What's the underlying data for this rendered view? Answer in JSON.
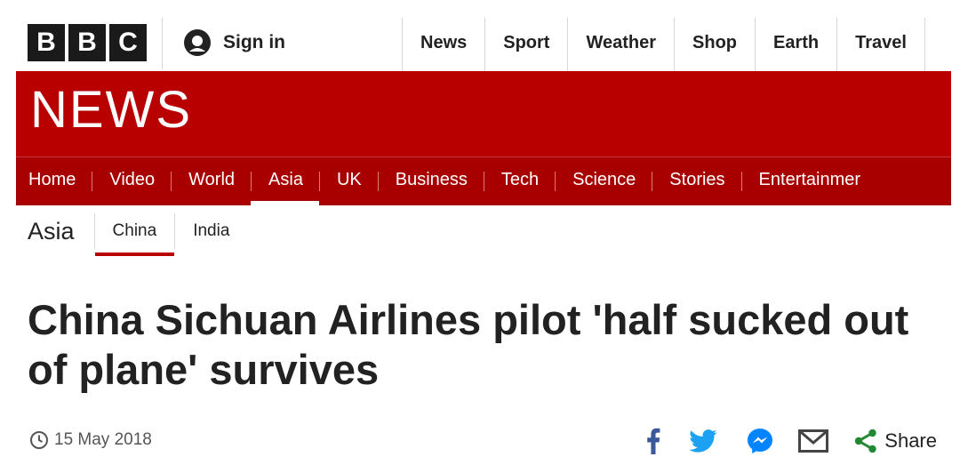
{
  "brand": {
    "letters": [
      "B",
      "B",
      "C"
    ],
    "section_logo": "NEWS",
    "accent_color": "#b80000"
  },
  "account": {
    "signin_label": "Sign in",
    "icon": "user-icon"
  },
  "top_nav": [
    "News",
    "Sport",
    "Weather",
    "Shop",
    "Earth",
    "Travel"
  ],
  "section_nav": {
    "items": [
      "Home",
      "Video",
      "World",
      "Asia",
      "UK",
      "Business",
      "Tech",
      "Science",
      "Stories",
      "Entertainmer"
    ],
    "active": "Asia"
  },
  "sub_nav": {
    "title": "Asia",
    "items": [
      "China",
      "India"
    ],
    "selected": "China"
  },
  "article": {
    "headline": "China Sichuan Airlines pilot 'half sucked out of plane' survives",
    "date": "15 May 2018"
  },
  "share": {
    "icons": [
      "facebook-icon",
      "twitter-icon",
      "messenger-icon",
      "email-icon",
      "share-icon"
    ],
    "label": "Share",
    "colors": {
      "facebook": "#3b5998",
      "twitter": "#1da1f2",
      "messenger": "#0084ff",
      "email": "#444444",
      "share": "#228833"
    }
  }
}
